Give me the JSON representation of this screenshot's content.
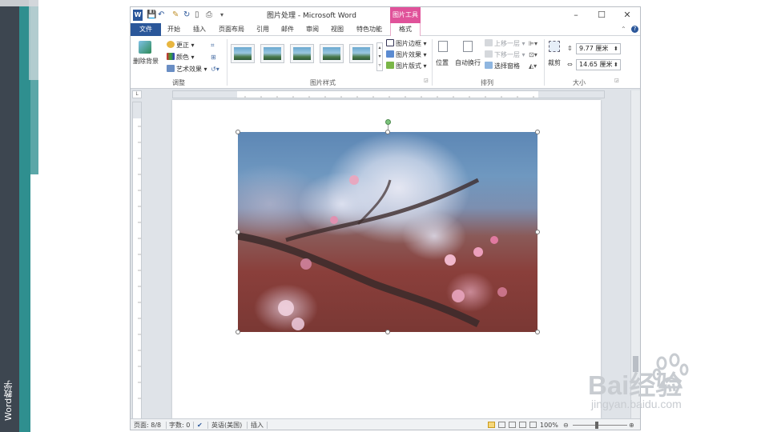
{
  "slide": {
    "side_label": "Word教学"
  },
  "window": {
    "title": "图片处理 - Microsoft Word",
    "contextual_tab_group": "图片工具",
    "controls": {
      "minimize": "–",
      "maximize": "☐",
      "close": "✕"
    }
  },
  "tabs": {
    "file": "文件",
    "items": [
      "开始",
      "插入",
      "页面布局",
      "引用",
      "邮件",
      "审阅",
      "视图",
      "特色功能"
    ],
    "format": "格式"
  },
  "ribbon": {
    "adjust": {
      "label": "调整",
      "remove_background": "删除背景",
      "corrections": "更正",
      "color": "颜色",
      "artistic_effects": "艺术效果"
    },
    "picture_styles": {
      "label": "图片样式",
      "picture_border": "图片边框",
      "picture_effects": "图片效果",
      "picture_layout": "图片版式"
    },
    "arrange": {
      "label": "排列",
      "position": "位置",
      "wrap_text": "自动换行",
      "bring_forward": "上移一层",
      "send_backward": "下移一层",
      "selection_pane": "选择窗格"
    },
    "size": {
      "label": "大小",
      "crop": "裁剪",
      "height": "9.77 厘米",
      "width": "14.65 厘米"
    }
  },
  "statusbar": {
    "page": "页面: 8/8",
    "words": "字数: 0",
    "language": "英语(美国)",
    "mode": "插入",
    "zoom": "100%"
  },
  "watermark": {
    "logo": "Bai经验",
    "url": "jingyan.baidu.com"
  },
  "colors": {
    "word_blue": "#2b579a",
    "picture_tools": "#e0529a",
    "teal": "#2f8f8f"
  }
}
